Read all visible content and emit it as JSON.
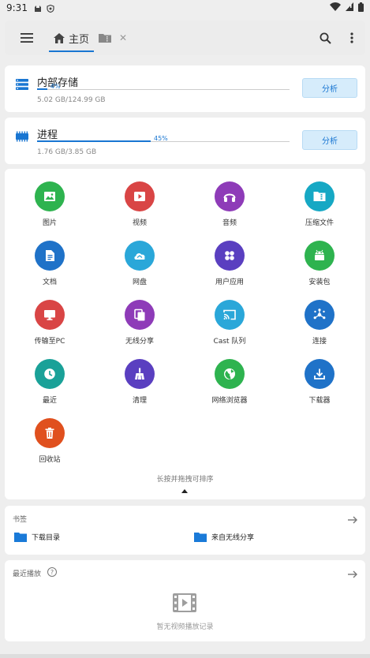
{
  "status_bar": {
    "time": "9:31"
  },
  "toolbar": {
    "tabs": [
      {
        "label": "主页",
        "icon": "home-icon",
        "active": true
      },
      {
        "label": "",
        "icon": "archive-folder-icon",
        "active": false
      }
    ]
  },
  "storage": {
    "internal": {
      "title": "内部存储",
      "percent_label": "4%",
      "percent": 4,
      "detail": "5.02 GB/124.99 GB",
      "button": "分析"
    },
    "process": {
      "title": "进程",
      "percent_label": "45%",
      "percent": 45,
      "detail": "1.76 GB/3.85 GB",
      "button": "分析"
    }
  },
  "categories": [
    {
      "label": "图片",
      "color": "#2eb34f",
      "icon": "image-icon"
    },
    {
      "label": "视频",
      "color": "#d94545",
      "icon": "video-icon"
    },
    {
      "label": "音频",
      "color": "#8e3bb8",
      "icon": "headphones-icon"
    },
    {
      "label": "压缩文件",
      "color": "#16a8c4",
      "icon": "archive-icon"
    },
    {
      "label": "文档",
      "color": "#1f72c8",
      "icon": "document-icon"
    },
    {
      "label": "网盘",
      "color": "#2aa7d9",
      "icon": "cloud-icon"
    },
    {
      "label": "用户应用",
      "color": "#5a3fc0",
      "icon": "apps-icon"
    },
    {
      "label": "安装包",
      "color": "#2eb34f",
      "icon": "android-icon"
    },
    {
      "label": "传输至PC",
      "color": "#d94545",
      "icon": "monitor-icon"
    },
    {
      "label": "无线分享",
      "color": "#8e3bb8",
      "icon": "copy-icon"
    },
    {
      "label": "Cast 队列",
      "color": "#2aa7d9",
      "icon": "cast-icon"
    },
    {
      "label": "连接",
      "color": "#1f72c8",
      "icon": "hub-icon"
    },
    {
      "label": "最近",
      "color": "#1aa198",
      "icon": "clock-icon"
    },
    {
      "label": "清理",
      "color": "#5a3fc0",
      "icon": "broom-icon"
    },
    {
      "label": "网络浏览器",
      "color": "#2eb34f",
      "icon": "globe-icon"
    },
    {
      "label": "下载器",
      "color": "#1f72c8",
      "icon": "download-icon"
    },
    {
      "label": "回收站",
      "color": "#e0501e",
      "icon": "trash-icon"
    }
  ],
  "hint": "长按并拖拽可排序",
  "bookmarks": {
    "title": "书签",
    "items": [
      {
        "label": "下载目录",
        "icon": "folder-icon"
      },
      {
        "label": "来自无线分享",
        "icon": "folder-icon"
      }
    ]
  },
  "recent": {
    "title": "最近播放",
    "empty": "暂无视频播放记录"
  },
  "colors": {
    "accent": "#1976d2",
    "folder": "#1a7ad8"
  }
}
